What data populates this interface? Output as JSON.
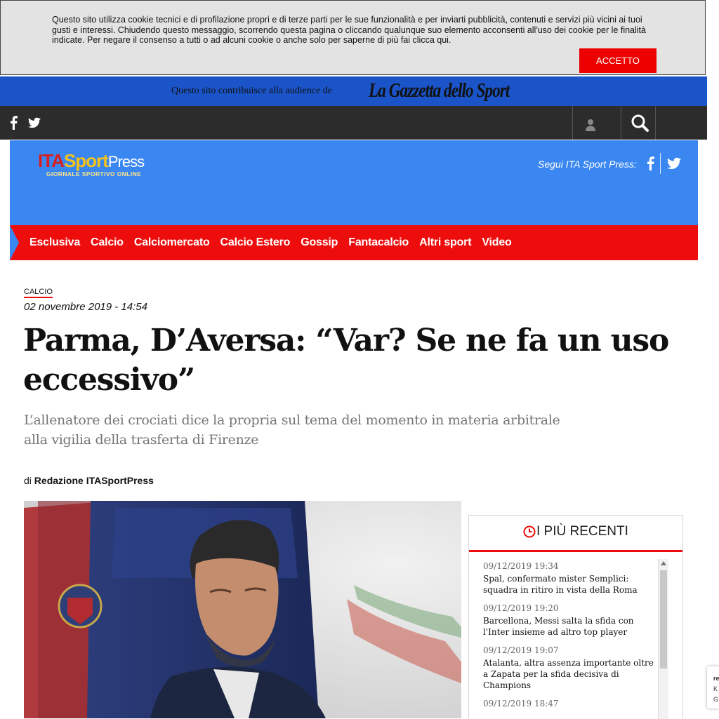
{
  "cookie": {
    "text": "Questo sito utilizza cookie tecnici e di profilazione propri e di terze parti per le sue funzionalità e per inviarti pubblicità, contenuti e servizi più vicini ai tuoi gusti e interessi. Chiudendo questo messaggio, scorrendo questa pagina o cliccando qualunque suo elemento acconsenti all'uso dei cookie per le finalità indicate. Per negare il consenso a tutti o ad alcuni cookie o anche solo per saperne di più fai clicca qui.",
    "accept_label": "ACCETTO"
  },
  "gazzetta": {
    "text": "Questo sito contribuisce alla audience de",
    "logo": "La Gazzetta dello Sport"
  },
  "topbar": {
    "icons": [
      "facebook-icon",
      "twitter-icon",
      "user-icon",
      "search-icon"
    ]
  },
  "header": {
    "logo_ita": "ITA",
    "logo_sport": "Sport",
    "logo_press": "Press",
    "logo_sub": "GIORNALE SPORTIVO ONLINE",
    "follow_text": "Segui ITA Sport Press:",
    "colors": {
      "header_bg": "#3a87f2",
      "nav_bg": "#ee0d0d"
    }
  },
  "nav": {
    "items": [
      "Esclusiva",
      "Calcio",
      "Calciomercato",
      "Calcio Estero",
      "Gossip",
      "Fantacalcio",
      "Altri sport",
      "Video"
    ]
  },
  "article": {
    "category": "CALCIO",
    "date": "02 novembre 2019 - 14:54",
    "title": "Parma, D’Aversa: “Var? Se ne fa un uso eccessivo”",
    "subtitle": "L’allenatore dei crociati dice la propria sul tema del momento in materia arbitrale alla vigilia della trasferta di Firenze",
    "byline_prefix": "di",
    "author": "Redazione ITASportPress"
  },
  "recent": {
    "title": "I PIÙ RECENTI",
    "items": [
      {
        "time": "09/12/2019 19:34",
        "text": "Spal, confermato mister Semplici: squadra in ritiro in vista della Roma"
      },
      {
        "time": "09/12/2019 19:20",
        "text": "Barcellona, Messi salta la sfida con l'Inter insieme ad altro top player"
      },
      {
        "time": "09/12/2019 19:07",
        "text": "Atalanta, altra assenza importante oltre a Zapata per la sfida decisiva di Champions"
      },
      {
        "time": "09/12/2019 18:47",
        "text": ""
      }
    ]
  },
  "side_tab": {
    "line1": "re",
    "line2": "K",
    "line3": "G"
  }
}
